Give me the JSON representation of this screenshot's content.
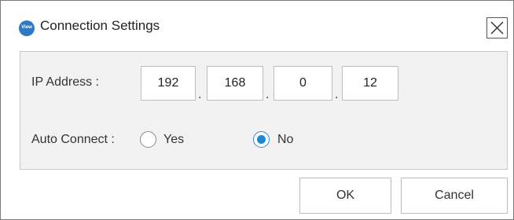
{
  "window": {
    "title": "Connection Settings",
    "icon": "view-app-icon",
    "icon_text": "View"
  },
  "ip": {
    "label": "IP Address :",
    "octets": [
      "192",
      "168",
      "0",
      "12"
    ],
    "separator": "."
  },
  "auto_connect": {
    "label": "Auto Connect :",
    "options": [
      "Yes",
      "No"
    ],
    "selected": "No"
  },
  "buttons": {
    "ok": "OK",
    "cancel": "Cancel"
  },
  "colors": {
    "accent": "#1e88d3",
    "panel_bg": "#f2f2f2"
  }
}
